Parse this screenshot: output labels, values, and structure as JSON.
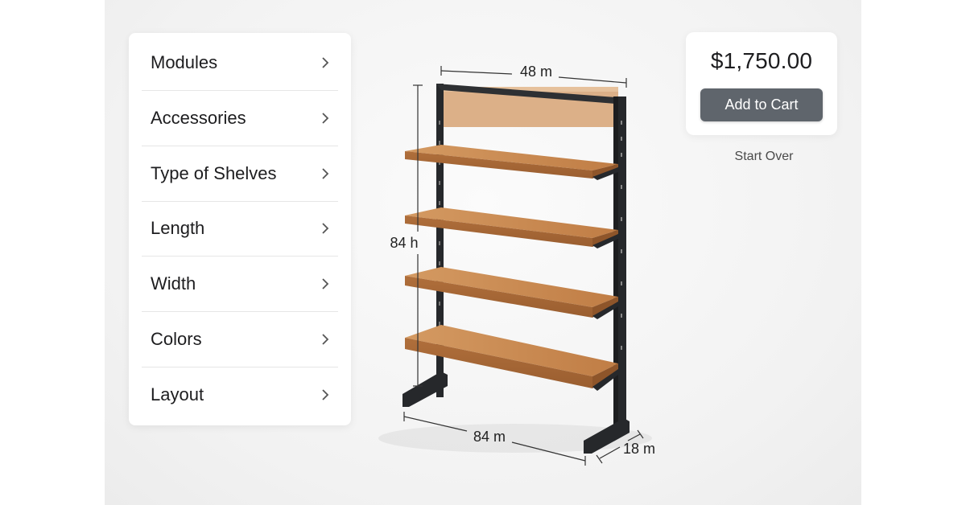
{
  "menu": {
    "items": [
      {
        "label": "Modules"
      },
      {
        "label": "Accessories"
      },
      {
        "label": "Type of Shelves"
      },
      {
        "label": "Length"
      },
      {
        "label": "Width"
      },
      {
        "label": "Colors"
      },
      {
        "label": "Layout"
      }
    ]
  },
  "summary": {
    "price": "$1,750.00",
    "add_to_cart_label": "Add to Cart",
    "start_over_label": "Start Over"
  },
  "dimensions": {
    "top": "48 m",
    "height": "84 h",
    "bottom": "84 m",
    "depth": "18 m"
  },
  "colors": {
    "frame": "#26282b",
    "wood": "#c8884f",
    "button": "#5f656c"
  }
}
